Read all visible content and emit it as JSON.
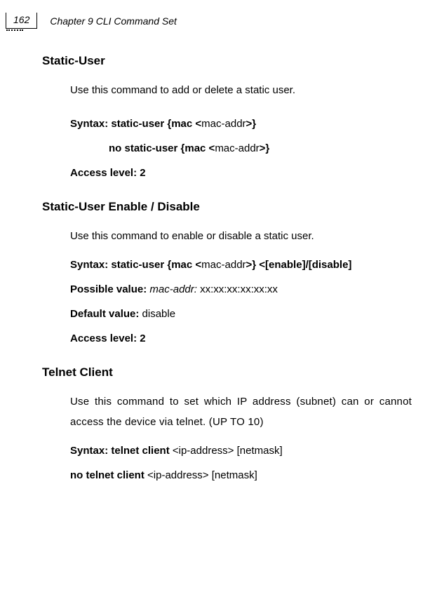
{
  "header": {
    "page_number": "162",
    "chapter": "Chapter 9 CLI Command Set"
  },
  "sections": {
    "s1": {
      "title": "Static-User",
      "desc": " Use this command to add or delete a static user.",
      "syntax_label": "Syntax: static-user {mac <",
      "syntax_arg": "mac-addr",
      "syntax_tail": ">}",
      "syntax2_label": "no static-user  {mac <",
      "syntax2_arg": "mac-addr",
      "syntax2_tail": ">}",
      "access": "Access level: 2"
    },
    "s2": {
      "title": "Static-User Enable / Disable",
      "desc": "Use this command to enable or disable a static user.",
      "syntax_label": "Syntax: static-user {mac <",
      "syntax_arg": "mac-addr",
      "syntax_tail": ">} <[enable]/[disable]",
      "possible_label": "Possible value: ",
      "possible_arg": "mac-addr:",
      "possible_val": " xx:xx:xx:xx:xx:xx",
      "default_label": "Default value:  ",
      "default_val": "disable",
      "access": "Access level: 2"
    },
    "s3": {
      "title": "Telnet Client",
      "desc": "Use this command to set which IP address (subnet) can or cannot access the device via telnet. (UP TO 10)",
      "syntax_label": "Syntax: telnet client ",
      "syntax_arg": "<ip-address> [netmask]",
      "syntax2_label": "no telnet client ",
      "syntax2_arg": "<ip-address> [netmask]"
    }
  }
}
